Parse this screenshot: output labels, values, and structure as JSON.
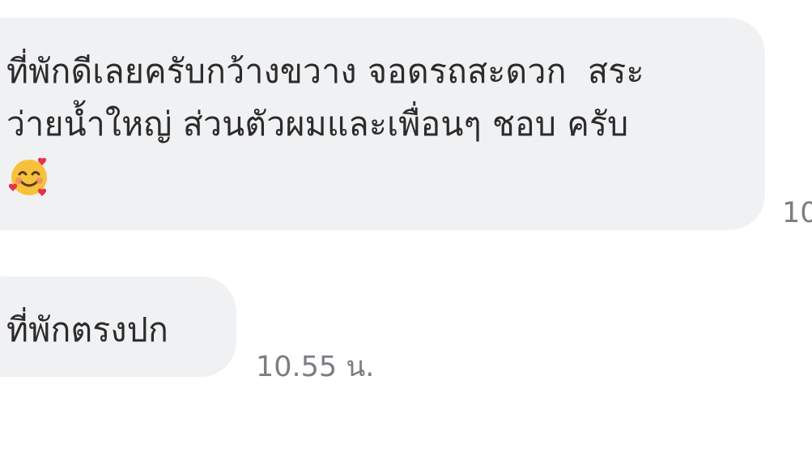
{
  "messages": [
    {
      "line1": "ที่พักดีเลยครับกว้างขวาง จอดรถสะดวก  สระ",
      "line2": "ว่ายน้ำใหญ่ ส่วนตัวผมและเพื่อนๆ ชอบ ครับ",
      "emoji": "smiling-face-with-hearts-icon",
      "timestamp": "10"
    },
    {
      "line1": "ที่พักตรงปก",
      "timestamp": "10.55 น."
    }
  ],
  "colors": {
    "bubble": "#f0f1f3",
    "text": "#2b2b2b",
    "timestamp": "#7a7d82"
  }
}
